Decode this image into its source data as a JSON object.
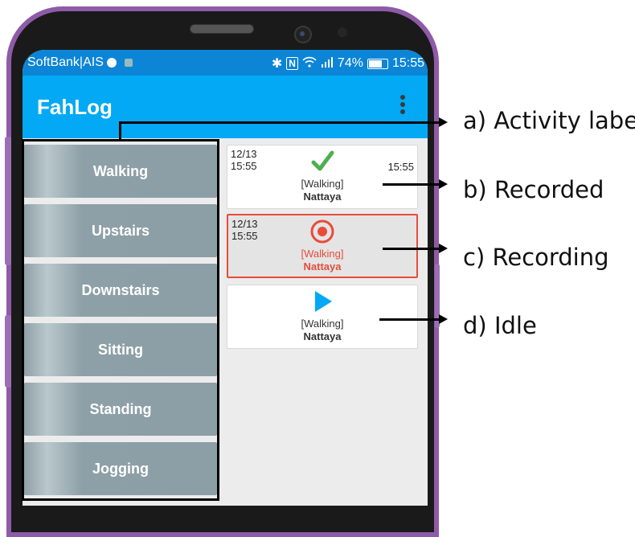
{
  "status_bar": {
    "carrier": "SoftBank|AIS",
    "icons": [
      "chrome-icon",
      "notification-icon",
      "bluetooth-icon",
      "nfc-icon",
      "wifi-icon",
      "signal-icon"
    ],
    "nfc_glyph": "N",
    "battery": "74%",
    "time": "15:55"
  },
  "app_bar": {
    "title": "FahLog",
    "menu_icon": "more-vert-icon"
  },
  "activity_labels": [
    {
      "label": "Walking"
    },
    {
      "label": "Upstairs"
    },
    {
      "label": "Downstairs"
    },
    {
      "label": "Sitting"
    },
    {
      "label": "Standing"
    },
    {
      "label": "Jogging"
    }
  ],
  "records": [
    {
      "state": "recorded",
      "icon": "check-icon",
      "date": "12/13",
      "start_time": "15:55",
      "end_time": "15:55",
      "activity": "[Walking]",
      "user": "Nattaya",
      "color": "#4caf50"
    },
    {
      "state": "recording",
      "icon": "record-icon",
      "date": "12/13",
      "start_time": "15:55",
      "activity": "[Walking]",
      "user": "Nattaya",
      "color": "#e74c3c"
    },
    {
      "state": "idle",
      "icon": "play-icon",
      "activity": "[Walking]",
      "user": "Nattaya",
      "color": "#03a9f4"
    }
  ],
  "annotations": [
    {
      "text": "a) Activity label"
    },
    {
      "text": "b) Recorded"
    },
    {
      "text": "c) Recording"
    },
    {
      "text": "d) Idle"
    }
  ],
  "colors": {
    "app_bar": "#03a9f4",
    "status_bar": "#0c85d6",
    "label_button": "#8c9ea6",
    "phone_frame": "#8e5ba8"
  }
}
